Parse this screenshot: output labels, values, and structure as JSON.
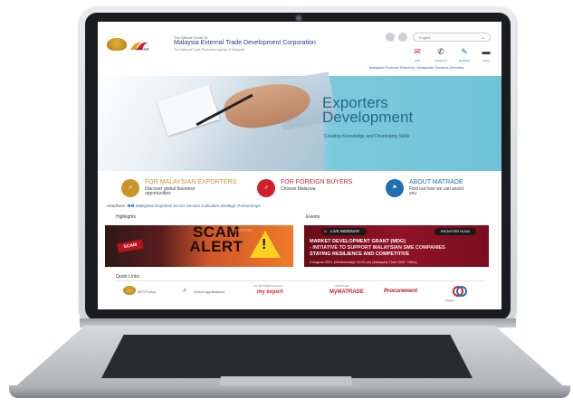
{
  "site": {
    "official_portal": "The Official Portal Of",
    "org_name": "Malaysia External Trade Development Corporation",
    "org_sub": "The National Trade Promotion Agency of Malaysia",
    "language_select": "English",
    "top_icons": [
      {
        "icon": "chat-icon",
        "label": "Chat"
      },
      {
        "icon": "phone-icon",
        "label": "Contact Us"
      },
      {
        "icon": "mail-icon",
        "label": "Feedback"
      },
      {
        "icon": "keyboard-icon",
        "label": "Assist"
      }
    ],
    "directories": "Malaysia Products Directory  |  Malaysian Services Directory"
  },
  "banner": {
    "title_line1": "Exporters",
    "title_line2": "Development",
    "subtitle": "Creating Knowledge and Developing Skills"
  },
  "categories": [
    {
      "title": "FOR MALAYSIAN EXPORTERS",
      "desc_line1": "Discover global business",
      "desc_line2": "opportunities",
      "color": "#c9942a"
    },
    {
      "title": "FOR FOREIGN BUYERS",
      "desc_line1": "Choose Malaysia",
      "desc_line2": "",
      "color": "#d11f2c"
    },
    {
      "title": "ABOUT MATRADE",
      "desc_line1": "Find out how we can assist",
      "desc_line2": "you",
      "color": "#1f6fb2"
    }
  ],
  "headlines": {
    "label": "Headlines:",
    "text": "Malaysian Expertise across Sectors Cultivates Strategic Partnerships"
  },
  "highlights": {
    "title": "Highlights",
    "key_label": "SCAM",
    "banner_line1": "SCAM",
    "banner_line2": "ALERT"
  },
  "events": {
    "title": "Events",
    "live_label": "LIVE WEBINAR",
    "register_label": "REGISTER NOW!",
    "line1": "MARKET DEVELOPMENT GRANT (MDG)",
    "line2": "- INITIATIVE TO SUPPORT MALAYSIAN SME COMPANIES",
    "line3": "STAYING RESILIENCE AND COMPETITIVE",
    "date": "4 August 2021 (Wednesday)  10:00 am (Malaysia Time GMT +8hrs)"
  },
  "quick_links": {
    "title": "Quick Links",
    "miti": "MITI Portal",
    "online_apps": "Online Applications",
    "myexport_caption": "(For MATRADE Members)",
    "myexport": "my export",
    "mymatrade_caption": "(Staff Portal)",
    "mymatrade": "MyMATRADE",
    "procurement": "Procurement",
    "integrity": "Integrity"
  }
}
